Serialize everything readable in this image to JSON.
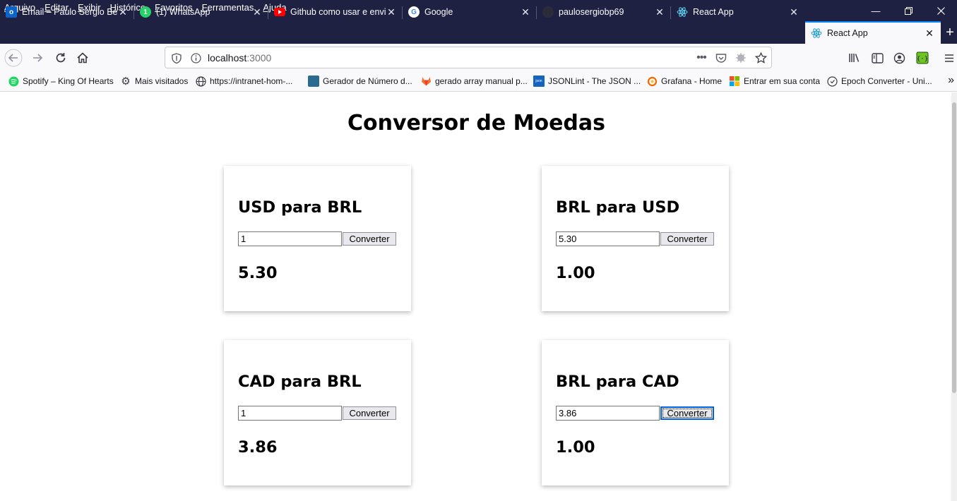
{
  "menu": [
    "Arquivo",
    "Editar",
    "Exibir",
    "Histórico",
    "Favoritos",
    "Ferramentas",
    "Ajuda"
  ],
  "tabs": [
    {
      "label": "Email – Paulo Sergio Ber",
      "icon": "outlook-icon"
    },
    {
      "label": "(1) WhatsApp",
      "icon": "whatsapp-icon"
    },
    {
      "label": "Github como usar e envi",
      "icon": "youtube-icon"
    },
    {
      "label": "Google",
      "icon": "google-icon"
    },
    {
      "label": "paulosergiobp69",
      "icon": "github-icon"
    },
    {
      "label": "React App",
      "icon": "react-icon"
    },
    {
      "label": "React App",
      "icon": "react-icon",
      "active": true
    }
  ],
  "url": {
    "host": "localhost",
    "port": ":3000"
  },
  "bookmarks": [
    {
      "label": "Spotify – King Of Hearts",
      "icon": "spotify-icon"
    },
    {
      "label": "Mais visitados",
      "icon": "gear-icon"
    },
    {
      "label": "https://intranet-hom-...",
      "icon": "globe-icon"
    },
    {
      "label": "Gerador de Número d...",
      "icon": "bookmark-icon"
    },
    {
      "label": "gerado array manual p...",
      "icon": "gitlab-icon"
    },
    {
      "label": "JSONLint - The JSON ...",
      "icon": "jsonlint-icon"
    },
    {
      "label": "Grafana - Home",
      "icon": "grafana-icon"
    },
    {
      "label": "Entrar em sua conta",
      "icon": "microsoft-icon"
    },
    {
      "label": "Epoch Converter - Uni...",
      "icon": "clock-icon"
    }
  ],
  "page": {
    "title": "Conversor de Moedas",
    "cards": [
      {
        "title": "USD para BRL",
        "input": "1",
        "button": "Converter",
        "result": "5.30"
      },
      {
        "title": "BRL para USD",
        "input": "5.30",
        "button": "Converter",
        "result": "1.00"
      },
      {
        "title": "CAD para BRL",
        "input": "1",
        "button": "Converter",
        "result": "3.86"
      },
      {
        "title": "BRL para CAD",
        "input": "3.86",
        "button": "Converter",
        "result": "1.00"
      }
    ]
  }
}
